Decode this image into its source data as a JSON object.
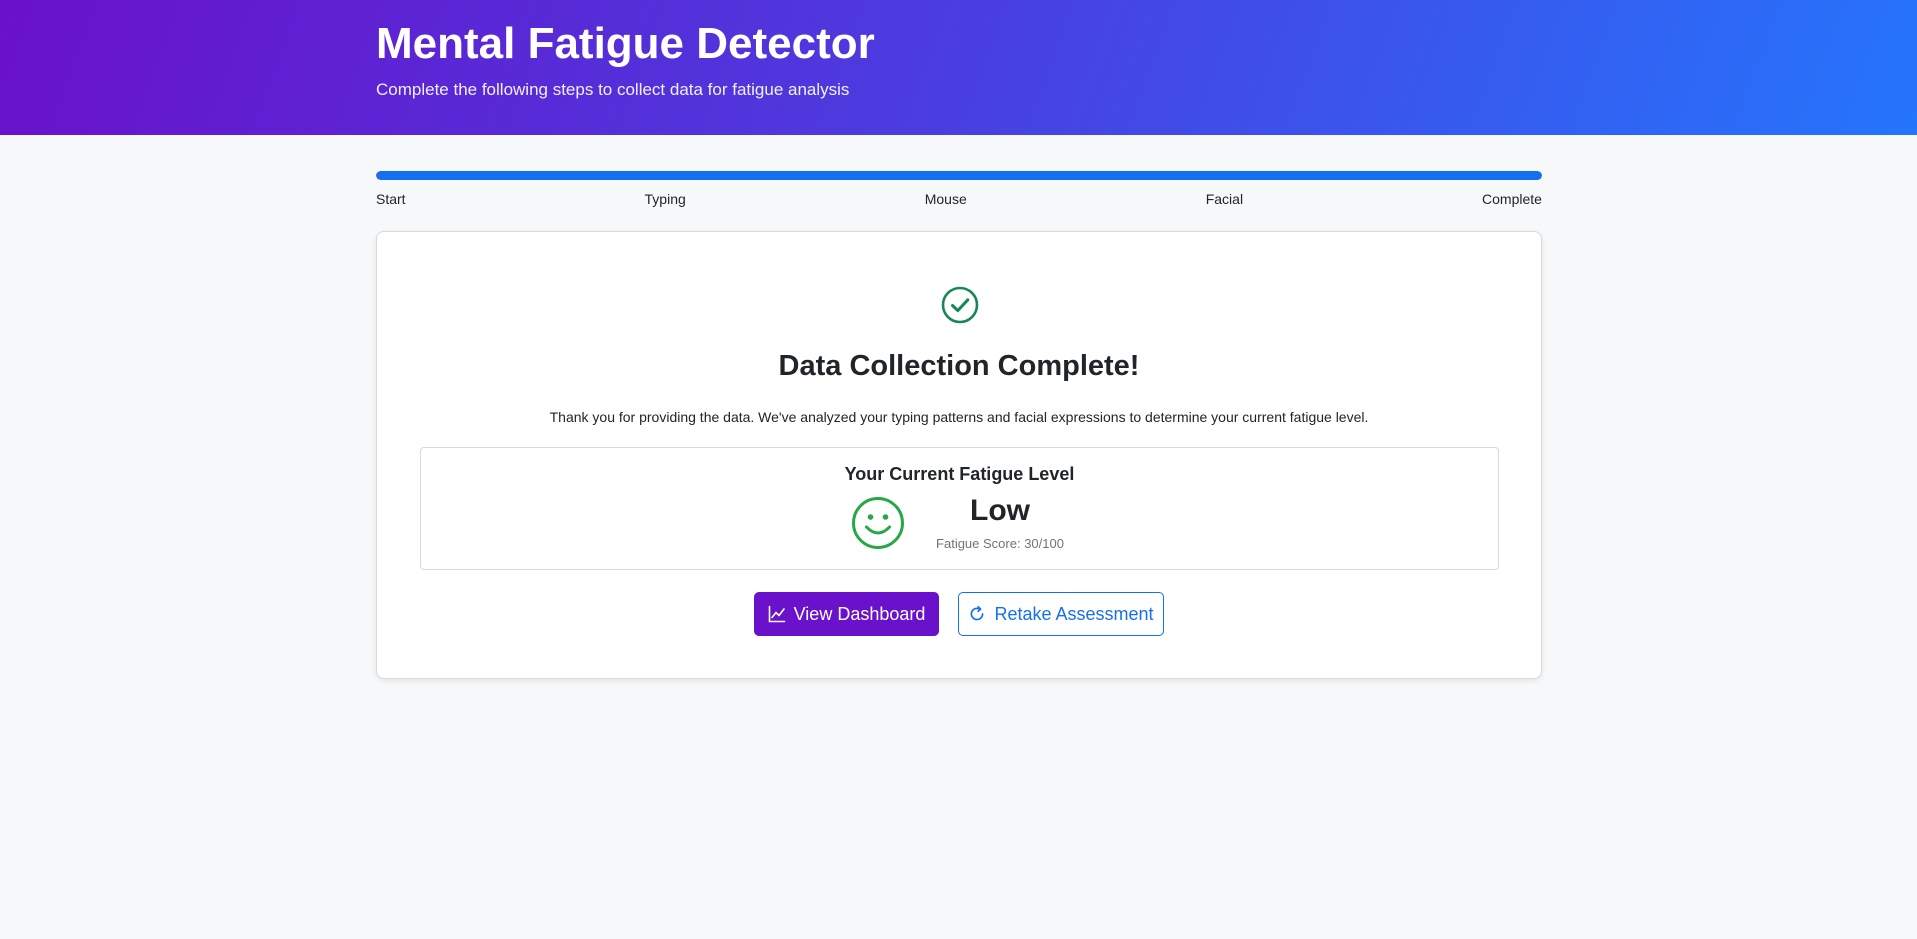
{
  "header": {
    "title": "Mental Fatigue Detector",
    "subtitle": "Complete the following steps to collect data for fatigue analysis"
  },
  "progress": {
    "percent": 100,
    "steps": [
      "Start",
      "Typing",
      "Mouse",
      "Facial",
      "Complete"
    ],
    "color": "#1570ef"
  },
  "completion": {
    "icon": "check-circle-icon",
    "title": "Data Collection Complete!",
    "message": "Thank you for providing the data. We've analyzed your typing patterns and facial expressions to determine your current fatigue level."
  },
  "result": {
    "heading": "Your Current Fatigue Level",
    "icon": "smile-icon",
    "level": "Low",
    "score_label": "Fatigue Score: 30/100",
    "level_color": "#28a745"
  },
  "actions": {
    "dashboard_label": "View Dashboard",
    "dashboard_icon": "chart-line-icon",
    "retake_label": "Retake Assessment",
    "retake_icon": "refresh-icon"
  },
  "colors": {
    "brand_purple": "#6a11cb",
    "brand_blue": "#2575fc",
    "success_green": "#198754"
  }
}
